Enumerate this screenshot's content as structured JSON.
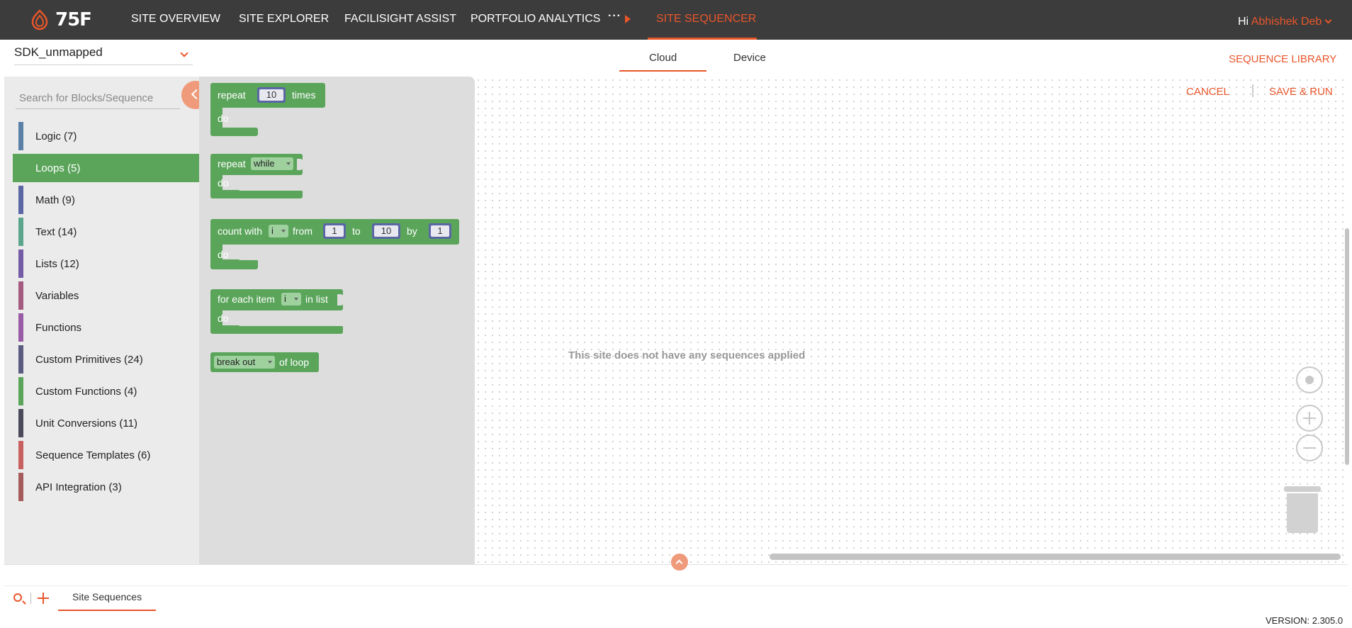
{
  "nav": {
    "logo_text": "75F",
    "items": [
      "SITE OVERVIEW",
      "SITE EXPLORER",
      "FACILISIGHT ASSIST",
      "PORTFOLIO ANALYTICS"
    ],
    "more": "···",
    "active": "SITE SEQUENCER",
    "greeting": "Hi",
    "user": "Abhishek Deb"
  },
  "site_select": {
    "value": "SDK_unmapped"
  },
  "tabs": [
    "Cloud",
    "Device"
  ],
  "sequence_library": "SEQUENCE LIBRARY",
  "search": {
    "placeholder": "Search for Blocks/Sequence"
  },
  "categories": [
    {
      "label": "Logic (7)",
      "color": "#5b80a5"
    },
    {
      "label": "Loops (5)",
      "color": "#5ba55b",
      "active": true
    },
    {
      "label": "Math (9)",
      "color": "#5b67a5"
    },
    {
      "label": "Text (14)",
      "color": "#5ba58c"
    },
    {
      "label": "Lists (12)",
      "color": "#745ba5"
    },
    {
      "label": "Variables",
      "color": "#a55b80"
    },
    {
      "label": "Functions",
      "color": "#995ba5"
    },
    {
      "label": "Custom Primitives (24)",
      "color": "#5b5b80"
    },
    {
      "label": "Custom Functions (4)",
      "color": "#5ba55b"
    },
    {
      "label": "Unit Conversions (11)",
      "color": "#4a4a5a"
    },
    {
      "label": "Sequence Templates (6)",
      "color": "#c96060"
    },
    {
      "label": "API Integration (3)",
      "color": "#a55b5b"
    }
  ],
  "blocks": {
    "repeat_times": {
      "repeat": "repeat",
      "count": "10",
      "times": "times",
      "do": "do"
    },
    "repeat_while": {
      "repeat": "repeat",
      "mode": "while",
      "do": "do"
    },
    "count_with": {
      "count_with": "count with",
      "var": "i",
      "from": "from",
      "from_val": "1",
      "to": "to",
      "to_val": "10",
      "by": "by",
      "by_val": "1",
      "do": "do"
    },
    "for_each": {
      "for_each": "for each item",
      "var": "i",
      "in_list": "in list",
      "do": "do"
    },
    "break_out": {
      "mode": "break out",
      "of_loop": "of loop"
    }
  },
  "workspace": {
    "cancel": "CANCEL",
    "save_run": "SAVE & RUN",
    "empty_message": "This site does not have any sequences applied"
  },
  "bottom": {
    "tab": "Site Sequences"
  },
  "version": "VERSION: 2.305.0",
  "colors": {
    "accent": "#e8562a",
    "block_green": "#5ba55b",
    "nav_bg": "#3c3c3c"
  },
  "icons": [
    "logo-icon",
    "search-icon",
    "plus-icon",
    "chevron-left-icon",
    "chevron-up-icon",
    "target-icon",
    "zoom-in-icon",
    "zoom-out-icon",
    "trash-icon"
  ]
}
